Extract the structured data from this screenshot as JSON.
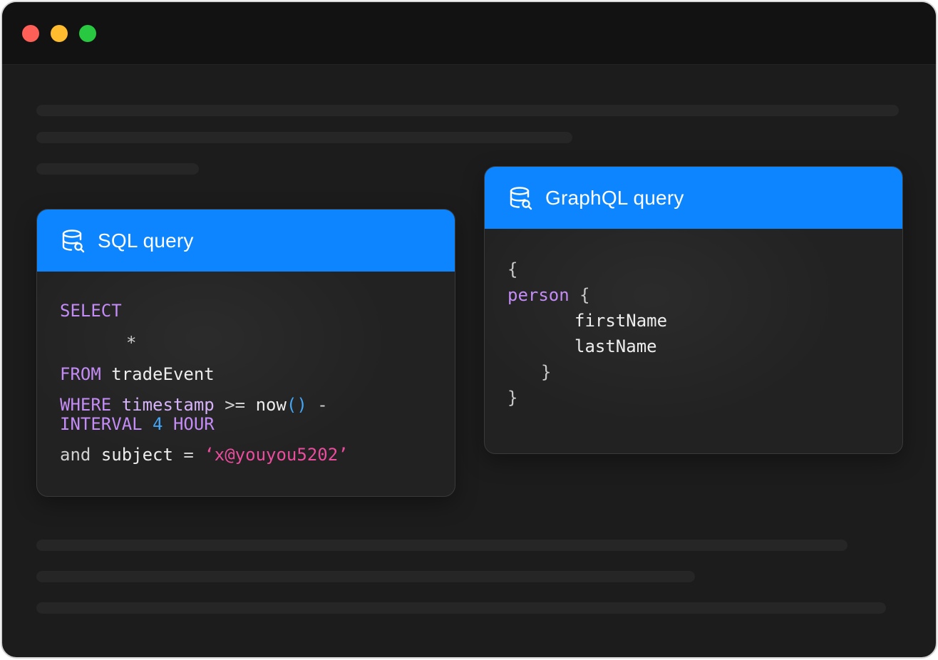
{
  "window": {
    "traffic_lights": {
      "close_color": "#fe5f57",
      "minimize_color": "#febc2e",
      "zoom_color": "#28c840"
    }
  },
  "colors": {
    "header_blue": "#0d85fe",
    "keyword_purple": "#c48cf6",
    "number_blue": "#42a6f7",
    "string_pink": "#ec4c9d",
    "background": "#1c1c1c",
    "card_background": "#222222"
  },
  "sql_card": {
    "icon": "database-search-icon",
    "title": "SQL query",
    "code": {
      "select": "SELECT",
      "star": "*",
      "from": "FROM",
      "table": "tradeEvent",
      "where": "WHERE",
      "column": "timestamp",
      "operator": ">=",
      "func": "now",
      "parens": "()",
      "minus": "-",
      "interval": "INTERVAL",
      "amount": "4",
      "unit": "HOUR",
      "and": "and",
      "subject": "subject",
      "equals": "=",
      "value": "‘x@youyou5202’"
    }
  },
  "graphql_card": {
    "icon": "database-search-icon",
    "title": "GraphQL query",
    "code": {
      "open_brace": "{",
      "field": "person",
      "field_open_brace": "{",
      "first_name": "firstName",
      "last_name": "lastName",
      "field_close_brace": "}",
      "close_brace": "}"
    }
  }
}
